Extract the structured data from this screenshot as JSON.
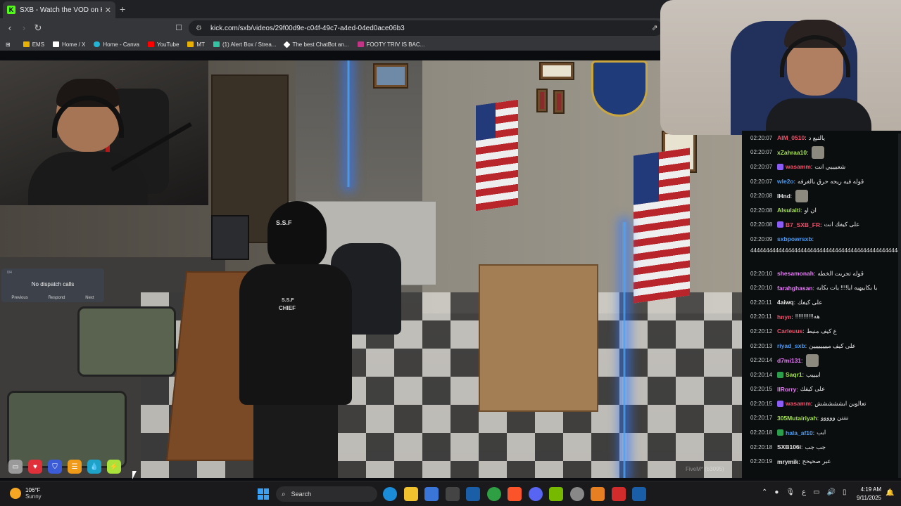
{
  "browser": {
    "tab_title": "SXB - Watch the VOD on Kick",
    "favicon_letter": "K",
    "url": "kick.com/sxb/videos/29f00d9e-c04f-49c7-a4ed-04ed0ace06b3",
    "bookmarks": [
      {
        "label": "EMS",
        "color": "#e8b000"
      },
      {
        "label": "Home / X",
        "color": "#ffffff"
      },
      {
        "label": "Home - Canva",
        "color": "#22b4d5"
      },
      {
        "label": "YouTube",
        "color": "#ff0000"
      },
      {
        "label": "MT",
        "color": "#e8b000"
      },
      {
        "label": "(1) Alert Box / Strea...",
        "color": "#31c3a2"
      },
      {
        "label": "The best ChatBot an...",
        "color": "#ffffff"
      },
      {
        "label": "FOOTY TRIV IS BAC...",
        "color": "#c13584"
      }
    ]
  },
  "game": {
    "vest_front": "S.S.F",
    "vest_back_line1": "S.S.F",
    "vest_back_line2": "CHIEF",
    "dispatch_header": "0/4",
    "dispatch_message": "No dispatch calls",
    "dispatch_previous": "Previous",
    "dispatch_respond": "Respond",
    "dispatch_next": "Next",
    "watermark": "FiveM* (b3095)"
  },
  "chat": {
    "messages": [
      {
        "ts": "02:20:07",
        "user": "AIM_0510",
        "color": "#f14f6a",
        "text": "يالتبع د"
      },
      {
        "ts": "02:20:07",
        "user": "xZahraa10",
        "color": "#a4e14d",
        "text": "",
        "emote": true
      },
      {
        "ts": "02:20:07",
        "user": "wasamm",
        "color": "#f14f6a",
        "text": "شعبيييي انت",
        "badge": "#8b5cf6"
      },
      {
        "ts": "02:20:07",
        "user": "wle2o",
        "color": "#4b9bf5",
        "text": "قوله فيه ريحه حرق بالغرفه"
      },
      {
        "ts": "02:20:08",
        "user": "IHnd",
        "color": "#e8e8e8",
        "text": "",
        "emote": true
      },
      {
        "ts": "02:20:08",
        "user": "Alsulaiti",
        "color": "#a4e14d",
        "text": "ان او"
      },
      {
        "ts": "02:20:08",
        "user": "B7_SXB_FR",
        "color": "#f14f6a",
        "text": "على كيفك انت",
        "badge": "#8b5cf6"
      },
      {
        "ts": "02:20:09",
        "user": "sxbpowrsxb",
        "color": "#4b9bf5",
        "text": ""
      },
      {
        "ts": "02:20:10",
        "user": "shesamonah",
        "color": "#e879f9",
        "text": "قوله تجربت الخطه"
      },
      {
        "ts": "02:20:10",
        "user": "farahghasan",
        "color": "#e879f9",
        "text": "يا بكاييهيه ايا!!!! يات بكايه"
      },
      {
        "ts": "02:20:11",
        "user": "4aiwq",
        "color": "#e8e8e8",
        "text": "على كيفك"
      },
      {
        "ts": "02:20:11",
        "user": "hnyn",
        "color": "#f14f6a",
        "text": "!!!!!!!!!!!هه"
      },
      {
        "ts": "02:20:12",
        "user": "Carleuus",
        "color": "#f14f6a",
        "text": "ع كيف منبط"
      },
      {
        "ts": "02:20:13",
        "user": "riyad_sxb",
        "color": "#4b9bf5",
        "text": "على كيف ميييييييين"
      },
      {
        "ts": "02:20:14",
        "user": "d7mi131",
        "color": "#e879f9",
        "text": "",
        "emote": true
      },
      {
        "ts": "02:20:14",
        "user": "Saqr1",
        "color": "#a4e14d",
        "text": "ابيييب",
        "badge": "#2b9e4b"
      },
      {
        "ts": "02:20:15",
        "user": "IIRorry",
        "color": "#e879f9",
        "text": "على كيفك"
      },
      {
        "ts": "02:20:15",
        "user": "wasamm",
        "color": "#f14f6a",
        "text": "تعالوين ابششششش",
        "badge": "#8b5cf6"
      },
      {
        "ts": "02:20:17",
        "user": "305Mutairiyah",
        "color": "#a4e14d",
        "text": "ننننن ووووو"
      },
      {
        "ts": "02:20:18",
        "user": "hala_af10",
        "color": "#4b9bf5",
        "text": "ابب",
        "badge": "#2b9e4b"
      },
      {
        "ts": "02:20:18",
        "user": "SXB106i",
        "color": "#e8e8e8",
        "text": "جب جب"
      },
      {
        "ts": "02:20:19",
        "user": "mrymik",
        "color": "#e8e8e8",
        "text": "عبر صحيحح"
      }
    ],
    "long_text": "44444444444444444444444444444444444444444444444444444444444"
  },
  "taskbar": {
    "temp": "106°F",
    "weather": "Sunny",
    "search": "Search",
    "time": "4:19 AM",
    "date": "9/11/2025"
  }
}
